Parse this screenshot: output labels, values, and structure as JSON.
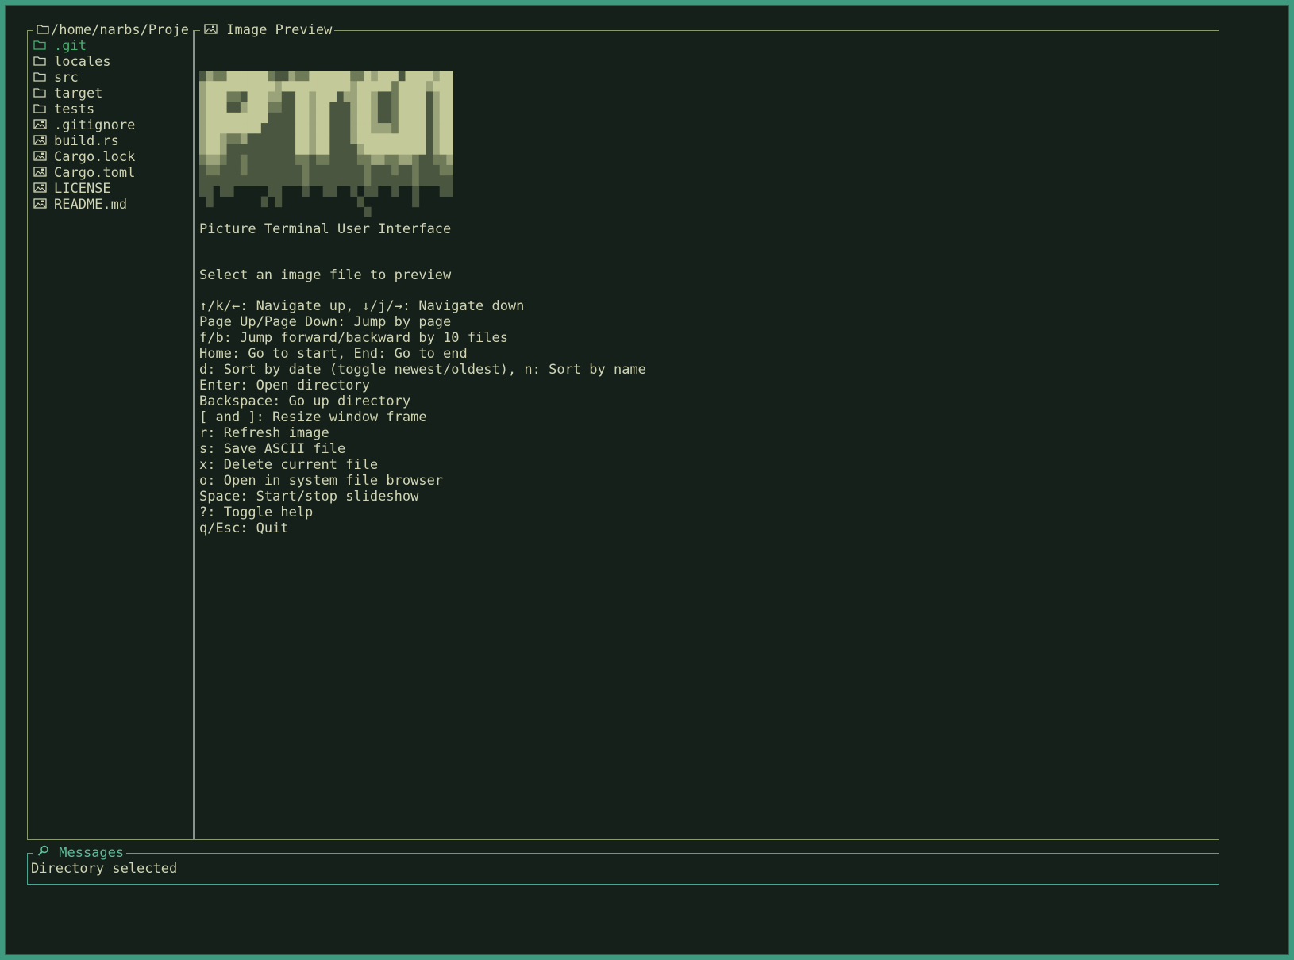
{
  "file_browser": {
    "path": "/home/narbs/Proje",
    "items": [
      {
        "name": ".git",
        "type": "folder",
        "selected": true
      },
      {
        "name": "locales",
        "type": "folder"
      },
      {
        "name": "src",
        "type": "folder"
      },
      {
        "name": "target",
        "type": "folder"
      },
      {
        "name": "tests",
        "type": "folder"
      },
      {
        "name": ".gitignore",
        "type": "file"
      },
      {
        "name": "build.rs",
        "type": "file"
      },
      {
        "name": "Cargo.lock",
        "type": "file"
      },
      {
        "name": "Cargo.toml",
        "type": "file"
      },
      {
        "name": "LICENSE",
        "type": "file"
      },
      {
        "name": "README.md",
        "type": "file"
      }
    ]
  },
  "preview": {
    "title": "Image Preview",
    "logo_alt": "PTUI",
    "subtitle": "Picture Terminal User Interface",
    "prompt": "Select an image file to preview",
    "help": [
      "↑/k/←: Navigate up, ↓/j/→: Navigate down",
      "Page Up/Page Down: Jump by page",
      "f/b: Jump forward/backward by 10 files",
      "Home: Go to start, End: Go to end",
      "d: Sort by date (toggle newest/oldest), n: Sort by name",
      "Enter: Open directory",
      "Backspace: Go up directory",
      "[ and ]: Resize window frame",
      "r: Refresh image",
      "s: Save ASCII file",
      "x: Delete current file",
      "o: Open in system file browser",
      "Space: Start/stop slideshow",
      "?: Toggle help",
      "q/Esc: Quit"
    ]
  },
  "messages": {
    "title": "Messages",
    "text": "Directory selected"
  },
  "icons": {
    "folder": "folder-icon",
    "file": "image-file-icon",
    "preview": "image-icon",
    "messages": "search-icon"
  },
  "colors": {
    "background": "#142019",
    "text": "#d0d4b4",
    "selected": "#46b072",
    "accent": "#5fbb99",
    "border": "#8a9a70",
    "window_border": "#3f9b7f"
  }
}
